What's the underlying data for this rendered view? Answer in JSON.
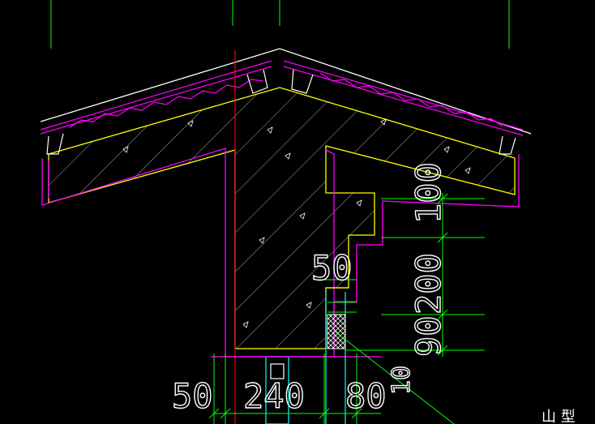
{
  "colors": {
    "background": "#000000",
    "roof_outline": "#ffffff",
    "tiles": "#ff00ff",
    "concrete_edge": "#ffff00",
    "dimension_lines": "#00ff00",
    "axis_line": "#ff0000",
    "hatch": "#ffffff",
    "column": "#00ffff",
    "insulation": "#ffffff"
  },
  "dimensions": {
    "left_50": "50",
    "bottom_240": "240",
    "bottom_80": "80",
    "mid_50": "50",
    "right_100": "100",
    "right_200": "200",
    "right_90": "90",
    "bottom_10": "10"
  },
  "corner_fragment": "山 型"
}
